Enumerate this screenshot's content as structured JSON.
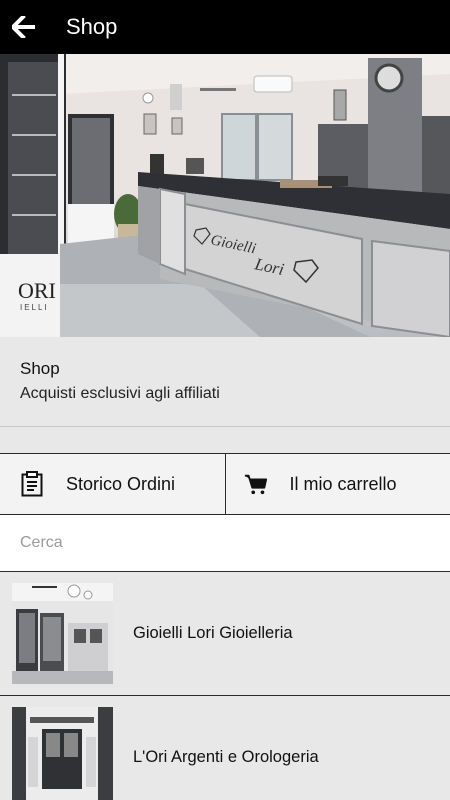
{
  "appbar": {
    "title": "Shop",
    "back_icon": "arrow-left-icon"
  },
  "intro": {
    "title": "Shop",
    "subtitle": "Acquisti esclusivi agli affiliati"
  },
  "actions": {
    "orders_label": "Storico Ordini",
    "orders_icon": "clipboard-icon",
    "cart_label": "Il mio carrello",
    "cart_icon": "cart-icon"
  },
  "search": {
    "placeholder": "Cerca",
    "value": ""
  },
  "shops": [
    {
      "name": "Gioielli Lori Gioielleria"
    },
    {
      "name": "L'Ori Argenti e Orologeria"
    }
  ],
  "hero": {
    "sign_line1": "Gioielli",
    "sign_line2": "Lori",
    "side_logo": "ORI",
    "side_logo_sub": "IELLI"
  }
}
